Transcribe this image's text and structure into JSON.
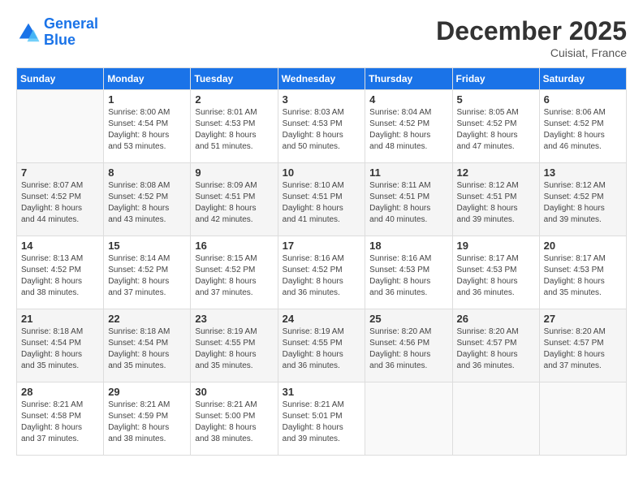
{
  "header": {
    "logo_line1": "General",
    "logo_line2": "Blue",
    "month_title": "December 2025",
    "location": "Cuisiat, France"
  },
  "weekdays": [
    "Sunday",
    "Monday",
    "Tuesday",
    "Wednesday",
    "Thursday",
    "Friday",
    "Saturday"
  ],
  "weeks": [
    [
      {
        "day": "",
        "info": ""
      },
      {
        "day": "1",
        "info": "Sunrise: 8:00 AM\nSunset: 4:54 PM\nDaylight: 8 hours\nand 53 minutes."
      },
      {
        "day": "2",
        "info": "Sunrise: 8:01 AM\nSunset: 4:53 PM\nDaylight: 8 hours\nand 51 minutes."
      },
      {
        "day": "3",
        "info": "Sunrise: 8:03 AM\nSunset: 4:53 PM\nDaylight: 8 hours\nand 50 minutes."
      },
      {
        "day": "4",
        "info": "Sunrise: 8:04 AM\nSunset: 4:52 PM\nDaylight: 8 hours\nand 48 minutes."
      },
      {
        "day": "5",
        "info": "Sunrise: 8:05 AM\nSunset: 4:52 PM\nDaylight: 8 hours\nand 47 minutes."
      },
      {
        "day": "6",
        "info": "Sunrise: 8:06 AM\nSunset: 4:52 PM\nDaylight: 8 hours\nand 46 minutes."
      }
    ],
    [
      {
        "day": "7",
        "info": "Sunrise: 8:07 AM\nSunset: 4:52 PM\nDaylight: 8 hours\nand 44 minutes."
      },
      {
        "day": "8",
        "info": "Sunrise: 8:08 AM\nSunset: 4:52 PM\nDaylight: 8 hours\nand 43 minutes."
      },
      {
        "day": "9",
        "info": "Sunrise: 8:09 AM\nSunset: 4:51 PM\nDaylight: 8 hours\nand 42 minutes."
      },
      {
        "day": "10",
        "info": "Sunrise: 8:10 AM\nSunset: 4:51 PM\nDaylight: 8 hours\nand 41 minutes."
      },
      {
        "day": "11",
        "info": "Sunrise: 8:11 AM\nSunset: 4:51 PM\nDaylight: 8 hours\nand 40 minutes."
      },
      {
        "day": "12",
        "info": "Sunrise: 8:12 AM\nSunset: 4:51 PM\nDaylight: 8 hours\nand 39 minutes."
      },
      {
        "day": "13",
        "info": "Sunrise: 8:12 AM\nSunset: 4:52 PM\nDaylight: 8 hours\nand 39 minutes."
      }
    ],
    [
      {
        "day": "14",
        "info": "Sunrise: 8:13 AM\nSunset: 4:52 PM\nDaylight: 8 hours\nand 38 minutes."
      },
      {
        "day": "15",
        "info": "Sunrise: 8:14 AM\nSunset: 4:52 PM\nDaylight: 8 hours\nand 37 minutes."
      },
      {
        "day": "16",
        "info": "Sunrise: 8:15 AM\nSunset: 4:52 PM\nDaylight: 8 hours\nand 37 minutes."
      },
      {
        "day": "17",
        "info": "Sunrise: 8:16 AM\nSunset: 4:52 PM\nDaylight: 8 hours\nand 36 minutes."
      },
      {
        "day": "18",
        "info": "Sunrise: 8:16 AM\nSunset: 4:53 PM\nDaylight: 8 hours\nand 36 minutes."
      },
      {
        "day": "19",
        "info": "Sunrise: 8:17 AM\nSunset: 4:53 PM\nDaylight: 8 hours\nand 36 minutes."
      },
      {
        "day": "20",
        "info": "Sunrise: 8:17 AM\nSunset: 4:53 PM\nDaylight: 8 hours\nand 35 minutes."
      }
    ],
    [
      {
        "day": "21",
        "info": "Sunrise: 8:18 AM\nSunset: 4:54 PM\nDaylight: 8 hours\nand 35 minutes."
      },
      {
        "day": "22",
        "info": "Sunrise: 8:18 AM\nSunset: 4:54 PM\nDaylight: 8 hours\nand 35 minutes."
      },
      {
        "day": "23",
        "info": "Sunrise: 8:19 AM\nSunset: 4:55 PM\nDaylight: 8 hours\nand 35 minutes."
      },
      {
        "day": "24",
        "info": "Sunrise: 8:19 AM\nSunset: 4:55 PM\nDaylight: 8 hours\nand 36 minutes."
      },
      {
        "day": "25",
        "info": "Sunrise: 8:20 AM\nSunset: 4:56 PM\nDaylight: 8 hours\nand 36 minutes."
      },
      {
        "day": "26",
        "info": "Sunrise: 8:20 AM\nSunset: 4:57 PM\nDaylight: 8 hours\nand 36 minutes."
      },
      {
        "day": "27",
        "info": "Sunrise: 8:20 AM\nSunset: 4:57 PM\nDaylight: 8 hours\nand 37 minutes."
      }
    ],
    [
      {
        "day": "28",
        "info": "Sunrise: 8:21 AM\nSunset: 4:58 PM\nDaylight: 8 hours\nand 37 minutes."
      },
      {
        "day": "29",
        "info": "Sunrise: 8:21 AM\nSunset: 4:59 PM\nDaylight: 8 hours\nand 38 minutes."
      },
      {
        "day": "30",
        "info": "Sunrise: 8:21 AM\nSunset: 5:00 PM\nDaylight: 8 hours\nand 38 minutes."
      },
      {
        "day": "31",
        "info": "Sunrise: 8:21 AM\nSunset: 5:01 PM\nDaylight: 8 hours\nand 39 minutes."
      },
      {
        "day": "",
        "info": ""
      },
      {
        "day": "",
        "info": ""
      },
      {
        "day": "",
        "info": ""
      }
    ]
  ]
}
